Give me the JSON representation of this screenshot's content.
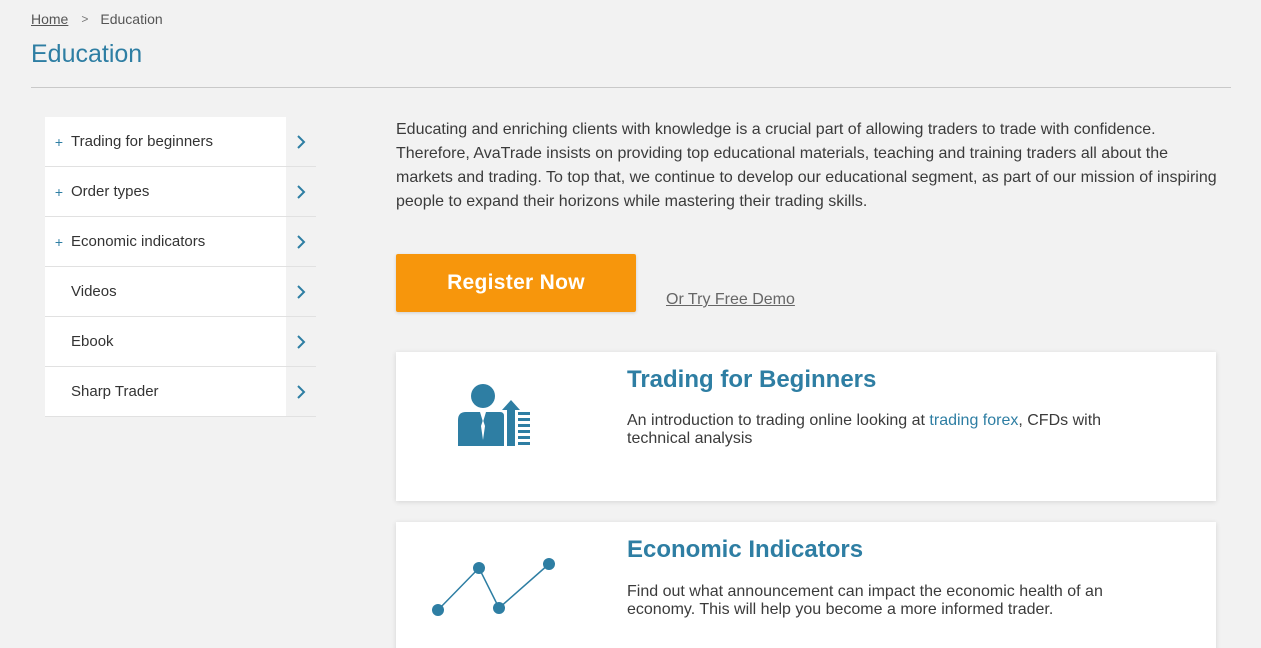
{
  "breadcrumb": {
    "home": "Home",
    "separator": ">",
    "current": "Education"
  },
  "page_title": "Education",
  "sidebar": {
    "items": [
      {
        "label": "Trading for beginners",
        "expandable": true
      },
      {
        "label": "Order types",
        "expandable": true
      },
      {
        "label": "Economic indicators",
        "expandable": true
      },
      {
        "label": "Videos",
        "expandable": false
      },
      {
        "label": "Ebook",
        "expandable": false
      },
      {
        "label": "Sharp Trader",
        "expandable": false
      }
    ],
    "plus_symbol": "+"
  },
  "intro_text": "Educating and enriching clients with knowledge is a crucial part of allowing traders to trade with confidence. Therefore, AvaTrade insists on providing top educational materials, teaching and training traders all about the markets and trading. To top that, we continue to develop our educational segment, as part of our mission of inspiring people to expand their horizons while mastering their trading skills.",
  "cta": {
    "register_label": "Register Now",
    "demo_label": "Or Try Free Demo"
  },
  "cards": [
    {
      "title": "Trading for Beginners",
      "desc_before": "An introduction to trading online looking at ",
      "desc_link": "trading forex",
      "desc_after": ", CFDs with technical analysis",
      "icon": "trader-growth-icon"
    },
    {
      "title": "Economic Indicators",
      "desc": "Find out what announcement can impact the economic health of an economy. This will help you become a more informed trader.",
      "icon": "line-graph-icon"
    }
  ],
  "colors": {
    "accent": "#2e7ea3",
    "cta": "#f7960c",
    "background": "#f2f2f2"
  }
}
